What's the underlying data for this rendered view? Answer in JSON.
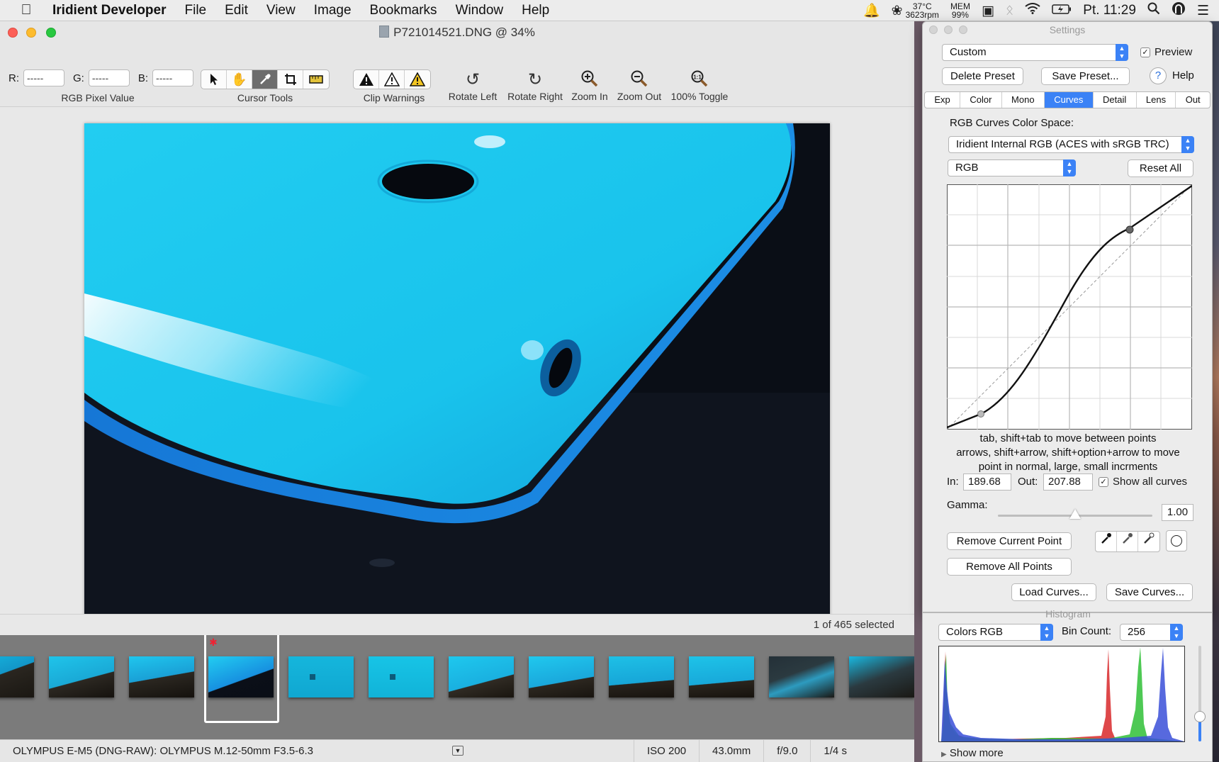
{
  "menubar": {
    "app_name": "Iridient Developer",
    "items": [
      "File",
      "Edit",
      "View",
      "Image",
      "Bookmarks",
      "Window",
      "Help"
    ],
    "temperature": "37°C",
    "fan_rpm": "3623rpm",
    "mem_label": "MEM",
    "mem_value": "99%",
    "clock": "Pt. 11:29"
  },
  "window": {
    "title": "P721014521.DNG @ 34%"
  },
  "toolbar": {
    "rgb": {
      "r_label": "R:",
      "g_label": "G:",
      "b_label": "B:",
      "r_value": "-----",
      "g_value": "-----",
      "b_value": "-----",
      "caption": "RGB Pixel Value"
    },
    "cursor_tools_caption": "Cursor Tools",
    "clip_warnings_caption": "Clip Warnings",
    "rotate_left": "Rotate Left",
    "rotate_right": "Rotate Right",
    "zoom_in": "Zoom In",
    "zoom_out": "Zoom Out",
    "toggle_100": "100% Toggle"
  },
  "status": {
    "selection": "1 of 465 selected"
  },
  "info": {
    "camera": "OLYMPUS E-M5 (DNG-RAW): OLYMPUS M.12-50mm F3.5-6.3",
    "iso": "ISO 200",
    "focal": "43.0mm",
    "aperture": "f/9.0",
    "shutter": "1/4 s"
  },
  "settings": {
    "title": "Settings",
    "preset": "Custom",
    "preview_label": "Preview",
    "preview_checked": true,
    "delete_preset": "Delete Preset",
    "save_preset": "Save Preset...",
    "help": "Help",
    "tabs": [
      {
        "label": "Exp",
        "active": false
      },
      {
        "label": "Color",
        "active": false
      },
      {
        "label": "Mono",
        "active": false
      },
      {
        "label": "Curves",
        "active": true
      },
      {
        "label": "Detail",
        "active": false
      },
      {
        "label": "Lens",
        "active": false
      },
      {
        "label": "Out",
        "active": false
      }
    ],
    "color_space_label": "RGB Curves Color Space:",
    "color_space": "Iridient Internal RGB (ACES with sRGB TRC)",
    "channel": "RGB",
    "reset_all": "Reset All",
    "help_text": [
      "tab, shift+tab to move between points",
      "arrows, shift+arrow, shift+option+arrow to move",
      "point in normal, large, small incrments"
    ],
    "in_label": "In:",
    "in_value": "189.68",
    "out_label": "Out:",
    "out_value": "207.88",
    "show_all_curves": "Show all curves",
    "show_all_checked": true,
    "gamma_label": "Gamma:",
    "gamma_value": "1.00",
    "remove_current": "Remove Current Point",
    "remove_all": "Remove All Points",
    "load_curves": "Load Curves...",
    "save_curves": "Save Curves..."
  },
  "histogram": {
    "title": "Histogram",
    "mode": "Colors RGB",
    "bin_label": "Bin Count:",
    "bin_count": "256",
    "show_more": "Show more"
  },
  "colors": {
    "accent": "#3b82f6",
    "photo_cyan": "#1fc8ee",
    "photo_bg": "#0a0e16"
  }
}
